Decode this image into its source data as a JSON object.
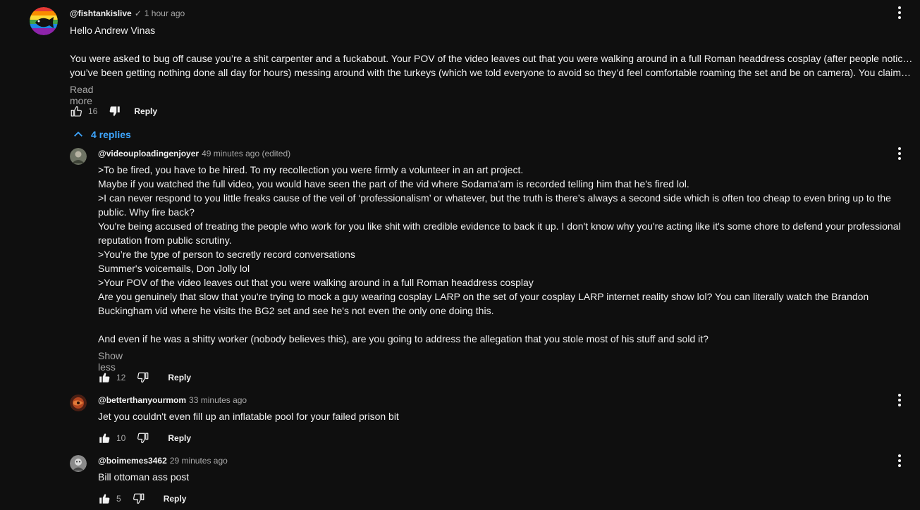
{
  "main_comment": {
    "author": "@fishtankislive",
    "verified": "✓",
    "time": "1 hour ago",
    "lines": [
      "Hello Andrew Vinas",
      "",
      "You were asked to bug off cause you’re a shit carpenter and a fuckabout. Your POV of the video leaves out that you were walking around in a full Roman headdress cosplay (after people noticing",
      "you’ve been getting nothing done all day for hours) messing around with the turkeys (which we told everyone to avoid so they’d feel comfortable roaming the set and be on camera). You claime..."
    ],
    "read_more": "Read more",
    "likes": "16",
    "reply_label": "Reply"
  },
  "replies_toggle": {
    "label": "4 replies"
  },
  "replies": [
    {
      "author": "@videouploadingenjoyer",
      "time": "49 minutes ago (edited)",
      "lines": [
        ">To be fired, you have to be hired. To my recollection you were firmly a volunteer in an art project.",
        "Maybe if you watched the full video, you would have seen the part of the vid where Sodama'am is recorded telling him that he's fired lol.",
        ">I can never respond to you little freaks cause of the veil of ‘professionalism’ or whatever, but the truth is there’s always a second side which is often too cheap to even bring up to the",
        "public. Why fire back?",
        "You're being accused of treating the people who work for you like shit with credible evidence to back it up. I don't know why you're acting like it's some chore to defend your professional",
        "reputation from public scrutiny.",
        ">You’re the type of person to secretly record conversations",
        "Summer's voicemails, Don Jolly lol",
        ">Your POV of the video leaves out that you were walking around in a full Roman headdress cosplay",
        "Are you genuinely that slow that you're trying to mock a guy wearing cosplay LARP on the set of your cosplay LARP internet reality show lol? You can literally watch the Brandon",
        "Buckingham vid where he visits the BG2 set and see he's not even the only one doing this.",
        "",
        "And even if he was a shitty worker (nobody believes this), are you going to address the allegation that you stole most of his stuff and sold it?"
      ],
      "show_less": "Show less",
      "likes": "12",
      "reply_label": "Reply"
    },
    {
      "author": "@betterthanyourmom",
      "time": "33 minutes ago",
      "lines": [
        "Jet you couldn't even fill up an inflatable pool for your failed prison bit"
      ],
      "likes": "10",
      "reply_label": "Reply"
    },
    {
      "author": "@boimemes3462",
      "time": "29 minutes ago",
      "lines": [
        "Bill ottoman ass post"
      ],
      "likes": "5",
      "reply_label": "Reply"
    }
  ],
  "colors": {
    "background": "#0f0f0f",
    "text": "#f1f1f1",
    "secondary": "#aaaaaa",
    "link_blue": "#3ea6ff"
  }
}
